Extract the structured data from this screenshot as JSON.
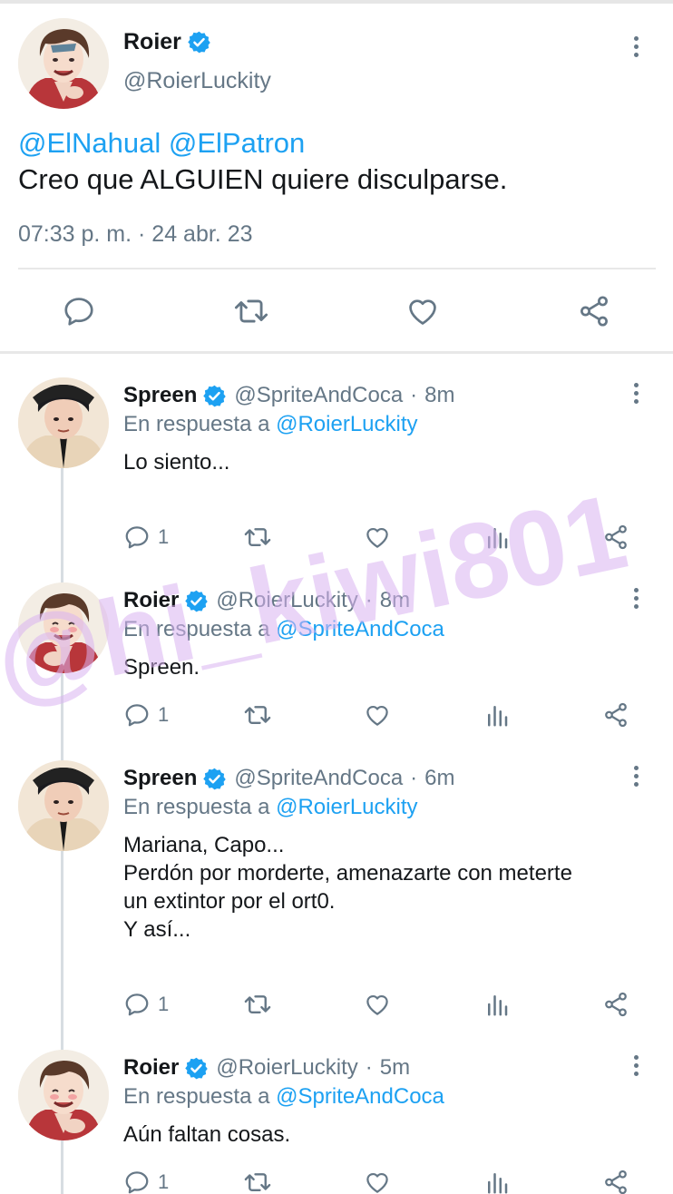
{
  "main": {
    "name": "Roier",
    "handle": "@RoierLuckity",
    "mentions": "@ElNahual @ElPatron",
    "text": "Creo que ALGUIEN quiere disculparse.",
    "timestamp": "07:33 p. m. · 24 abr. 23",
    "actions": [
      "reply-icon",
      "retweet-icon",
      "like-icon",
      "share-icon"
    ]
  },
  "replies": [
    {
      "name": "Spreen",
      "handle": "@SpriteAndCoca",
      "time": "8m",
      "reply_prefix": "En respuesta a",
      "reply_to": "@RoierLuckity",
      "text": "Lo siento...",
      "reply_count": "1"
    },
    {
      "name": "Roier",
      "handle": "@RoierLuckity",
      "time": "8m",
      "reply_prefix": "En respuesta a",
      "reply_to": "@SpriteAndCoca",
      "text": "Spreen.",
      "reply_count": "1"
    },
    {
      "name": "Spreen",
      "handle": "@SpriteAndCoca",
      "time": "6m",
      "reply_prefix": "En respuesta a",
      "reply_to": "@RoierLuckity",
      "text": "Mariana, Capo...\nPerdón por morderte, amenazarte con meterte\nun extintor por el ort0.\nY así...",
      "reply_count": "1"
    },
    {
      "name": "Roier",
      "handle": "@RoierLuckity",
      "time": "5m",
      "reply_prefix": "En respuesta a",
      "reply_to": "@SpriteAndCoca",
      "text": "Aún faltan cosas.",
      "reply_count": "1"
    }
  ],
  "separator": "·",
  "watermark": "@hi_kiwi801",
  "colors": {
    "link": "#1da1f2",
    "muted": "#657786",
    "verified": "#1da1f2",
    "watermark": "#d9b3f0"
  }
}
